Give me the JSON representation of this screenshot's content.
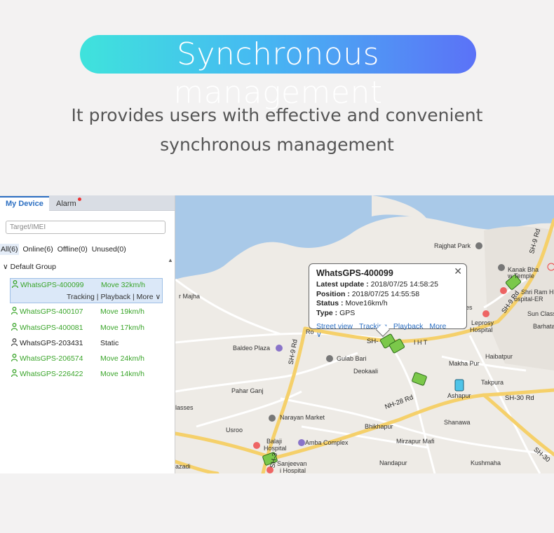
{
  "hero": {
    "title": "Synchronous management",
    "subtitle_line1": "It provides users with effective and convenient",
    "subtitle_line2": "synchronous management"
  },
  "panel": {
    "tabs": [
      {
        "label": "My Device",
        "active": true
      },
      {
        "label": "Alarm",
        "badge": "red-dot"
      }
    ],
    "search_placeholder": "Target/IMEI",
    "filters": [
      "All(6)",
      "Online(6)",
      "Offline(0)",
      "Unused(0)"
    ],
    "group_label": "Default Group",
    "devices": [
      {
        "name": "WhatsGPS-400099",
        "status": "Move 32km/h",
        "online": true,
        "selected": true
      },
      {
        "name": "WhatsGPS-400107",
        "status": "Move 19km/h",
        "online": true
      },
      {
        "name": "WhatsGPS-400081",
        "status": "Move 17km/h",
        "online": true
      },
      {
        "name": "WhatsGPS-203431",
        "status": "Static",
        "online": false
      },
      {
        "name": "WhatsGPS-206574",
        "status": "Move 24km/h",
        "online": true
      },
      {
        "name": "WhatsGPS-226422",
        "status": "Move 14km/h",
        "online": true
      }
    ],
    "selected_actions": {
      "tracking": "Tracking",
      "sep1": " | ",
      "playback": "Playback",
      "sep2": " | ",
      "more": "More"
    }
  },
  "popup": {
    "title": "WhatsGPS-400099",
    "latest_update_label": "Latest update :",
    "latest_update": "2018/07/25 14:58:25",
    "position_label": "Position :",
    "position": "2018/07/25 14:55:58",
    "status_label": "Status :",
    "status": "Move16km/h",
    "type_label": "Type :",
    "type": "GPS",
    "links": {
      "street_view": "Street view",
      "tracking": "Tracking",
      "playback": "Playback",
      "more": "More"
    }
  },
  "map": {
    "places": [
      "Rajghat Park",
      "Kanak Bha",
      "w Temple",
      "Shri Ram H",
      "ospital-ER",
      "Sun Class",
      "Barhata",
      "Leprosy",
      "Hospital",
      "Haibatpur",
      "Makha Pur",
      "Takpura",
      "Ashapur",
      "r Majha",
      "Baldeo Plaza",
      "Gulab Bari",
      "Deokaali",
      "Pahar Ganj",
      "lasses",
      "Narayan Market",
      "Usroo",
      "Balaji",
      "Hospital",
      "Amba Complex",
      "Sanjeevan",
      "i Hospital",
      "azadi",
      "Bhikhapur",
      "Shanawa",
      "Mirzapur Mafi",
      "Nandapur",
      "Kushmaha",
      "es",
      "I H T",
      "Ro"
    ],
    "roads": [
      "SH-9 Rd",
      "SH-9 Rd",
      "SH-9 Rd",
      "SH-30 Rd",
      "NH-28 Rd",
      "SH-",
      "SH-30",
      "SH-3"
    ]
  }
}
